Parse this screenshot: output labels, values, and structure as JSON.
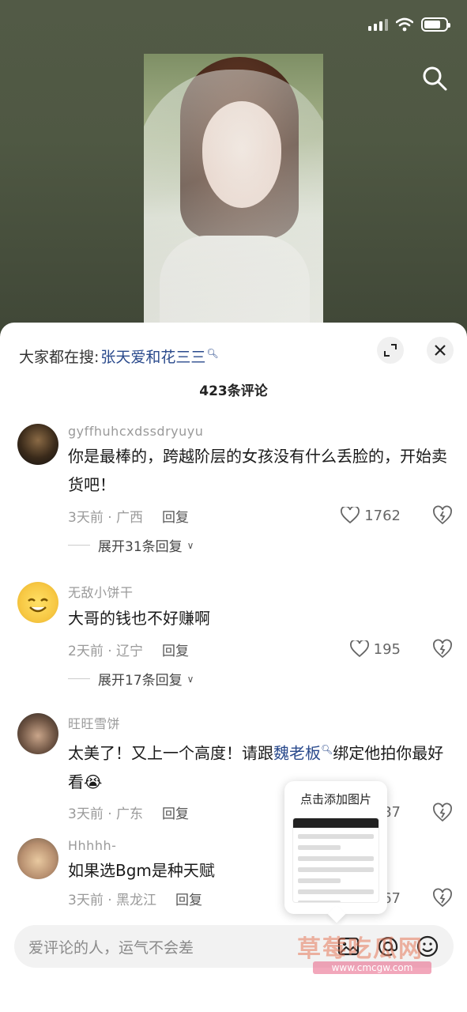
{
  "trending": {
    "prefix": "大家都在搜:",
    "keyword": "张天爱和花三三"
  },
  "comment_count": "423条评论",
  "comments": [
    {
      "user": "gyffhuhcxdssdryuyu",
      "text": "你是最棒的，跨越阶层的女孩没有什么丢脸的，开始卖货吧！",
      "time": "3天前 · 广西",
      "reply": "回复",
      "likes": "1762",
      "expand": "展开31条回复"
    },
    {
      "user": "无敌小饼干",
      "text": "大哥的钱也不好赚啊",
      "time": "2天前 · 辽宁",
      "reply": "回复",
      "likes": "195",
      "expand": "展开17条回复"
    },
    {
      "user": "旺旺雪饼",
      "text_before": "太美了！又上一个高度！请跟",
      "keyword": "魏老板",
      "text_after": "绑定他拍你最好看😭",
      "time": "3天前 · 广东",
      "reply": "回复",
      "likes": "87"
    },
    {
      "user": "Hhhhh-",
      "text": "如果选Bgm是种天赋",
      "time": "3天前 · 黑龙江",
      "reply": "回复",
      "likes": "67"
    }
  ],
  "popup": {
    "title": "点击添加图片"
  },
  "input": {
    "placeholder": "爱评论的人，运气不会差"
  },
  "watermark": {
    "text": "草莓吃瓜网",
    "url": "www.cmcgw.com"
  },
  "colors": {
    "keyword": "#2a4a8c",
    "accent_text": "#1a1a1a",
    "muted": "#9a9a9a"
  },
  "icons": [
    "signal-icon",
    "wifi-icon",
    "battery-icon",
    "search-icon",
    "expand-icon",
    "close-icon",
    "heart-icon",
    "dislike-icon",
    "image-icon",
    "at-icon",
    "emoji-icon"
  ]
}
